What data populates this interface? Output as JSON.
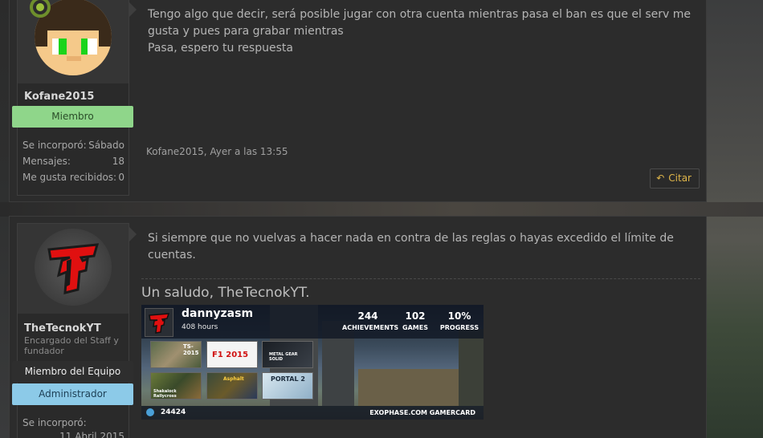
{
  "posts": [
    {
      "user": {
        "name": "Kofane2015",
        "title": "",
        "banners": [
          "Miembro"
        ],
        "stats": [
          {
            "label": "Se incorporó:",
            "value": "Sábado"
          },
          {
            "label": "Mensajes:",
            "value": "18"
          },
          {
            "label": "Me gusta recibidos:",
            "value": "0"
          }
        ],
        "online": true
      },
      "message_lines": [
        "Tengo algo que decir, será posible jugar con otra cuenta mientras pasa el ban es que el serv me",
        "gusta y pues para grabar mientras",
        "Pasa, espero tu respuesta"
      ],
      "meta": "Kofane2015, Ayer a las 13:55",
      "cite_label": "Citar"
    },
    {
      "user": {
        "name": "TheTecnokYT",
        "title": "Encargado del Staff y fundador",
        "banners": [
          "Miembro del Equipo",
          "Administrador"
        ],
        "stats": [
          {
            "label": "Se incorporó:",
            "value": "11 Abril 2015"
          }
        ]
      },
      "message_lines": [
        "Si siempre que no vuelvas a hacer nada en contra de las reglas o hayas excedido el límite de",
        "cuentas."
      ],
      "signature": {
        "text": "Un saludo, TheTecnokYT.",
        "gamercard": {
          "username": "dannyzasm",
          "hours": "408 hours",
          "stats": [
            {
              "value": "244",
              "label": "ACHIEVEMENTS"
            },
            {
              "value": "102",
              "label": "GAMES"
            },
            {
              "value": "10%",
              "label": "PROGRESS"
            }
          ],
          "games": [
            "TS-2015",
            "F1 2015",
            "METAL GEAR SOLID",
            "Shakalock Rallycross",
            "Asphalt",
            "PORTAL 2"
          ],
          "points": "24424",
          "brand": "EXOPHASE.COM GAMERCARD"
        }
      }
    }
  ],
  "colors": {
    "member_banner": "#8fd68a",
    "admin_banner": "#8ccae8",
    "cite_text": "#e0b64a",
    "online_ring": "#9bc13b"
  },
  "icons": {
    "cite": "reply-arrow-icon",
    "online": "online-status-icon"
  }
}
